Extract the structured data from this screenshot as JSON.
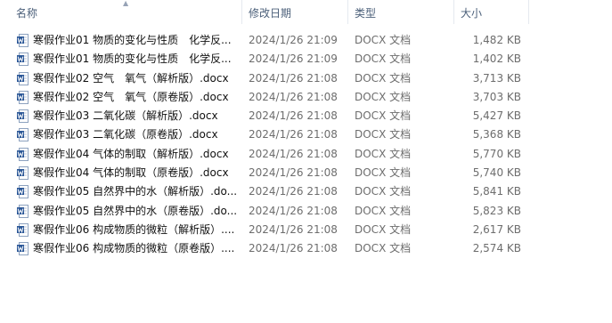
{
  "columns": {
    "name": "名称",
    "date": "修改日期",
    "type": "类型",
    "size": "大小"
  },
  "files": [
    {
      "name": "寒假作业01 物质的变化与性质　化学反...",
      "date": "2024/1/26 21:09",
      "type": "DOCX 文档",
      "size": "1,482 KB",
      "icon": "word-doc-icon"
    },
    {
      "name": "寒假作业01 物质的变化与性质　化学反...",
      "date": "2024/1/26 21:09",
      "type": "DOCX 文档",
      "size": "1,402 KB",
      "icon": "word-doc-icon"
    },
    {
      "name": "寒假作业02 空气　氧气（解析版）.docx",
      "date": "2024/1/26 21:08",
      "type": "DOCX 文档",
      "size": "3,713 KB",
      "icon": "word-doc-icon"
    },
    {
      "name": "寒假作业02 空气　氧气（原卷版）.docx",
      "date": "2024/1/26 21:08",
      "type": "DOCX 文档",
      "size": "3,703 KB",
      "icon": "word-doc-icon"
    },
    {
      "name": "寒假作业03 二氧化碳（解析版）.docx",
      "date": "2024/1/26 21:08",
      "type": "DOCX 文档",
      "size": "5,427 KB",
      "icon": "word-doc-icon"
    },
    {
      "name": "寒假作业03 二氧化碳（原卷版）.docx",
      "date": "2024/1/26 21:08",
      "type": "DOCX 文档",
      "size": "5,368 KB",
      "icon": "word-doc-icon"
    },
    {
      "name": "寒假作业04 气体的制取（解析版）.docx",
      "date": "2024/1/26 21:08",
      "type": "DOCX 文档",
      "size": "5,770 KB",
      "icon": "word-doc-icon"
    },
    {
      "name": "寒假作业04 气体的制取（原卷版）.docx",
      "date": "2024/1/26 21:08",
      "type": "DOCX 文档",
      "size": "5,740 KB",
      "icon": "word-doc-icon"
    },
    {
      "name": "寒假作业05 自然界中的水（解析版）.do...",
      "date": "2024/1/26 21:08",
      "type": "DOCX 文档",
      "size": "5,841 KB",
      "icon": "word-doc-icon"
    },
    {
      "name": "寒假作业05 自然界中的水（原卷版）.do...",
      "date": "2024/1/26 21:08",
      "type": "DOCX 文档",
      "size": "5,823 KB",
      "icon": "word-doc-icon"
    },
    {
      "name": "寒假作业06 构成物质的微粒（解析版）....",
      "date": "2024/1/26 21:08",
      "type": "DOCX 文档",
      "size": "2,617 KB",
      "icon": "word-doc-icon"
    },
    {
      "name": "寒假作业06 构成物质的微粒（原卷版）....",
      "date": "2024/1/26 21:08",
      "type": "DOCX 文档",
      "size": "2,574 KB",
      "icon": "word-doc-icon"
    }
  ],
  "colors": {
    "header_text": "#4c607a",
    "detail_text": "#6d6d6d",
    "icon_blue": "#2b5797"
  }
}
